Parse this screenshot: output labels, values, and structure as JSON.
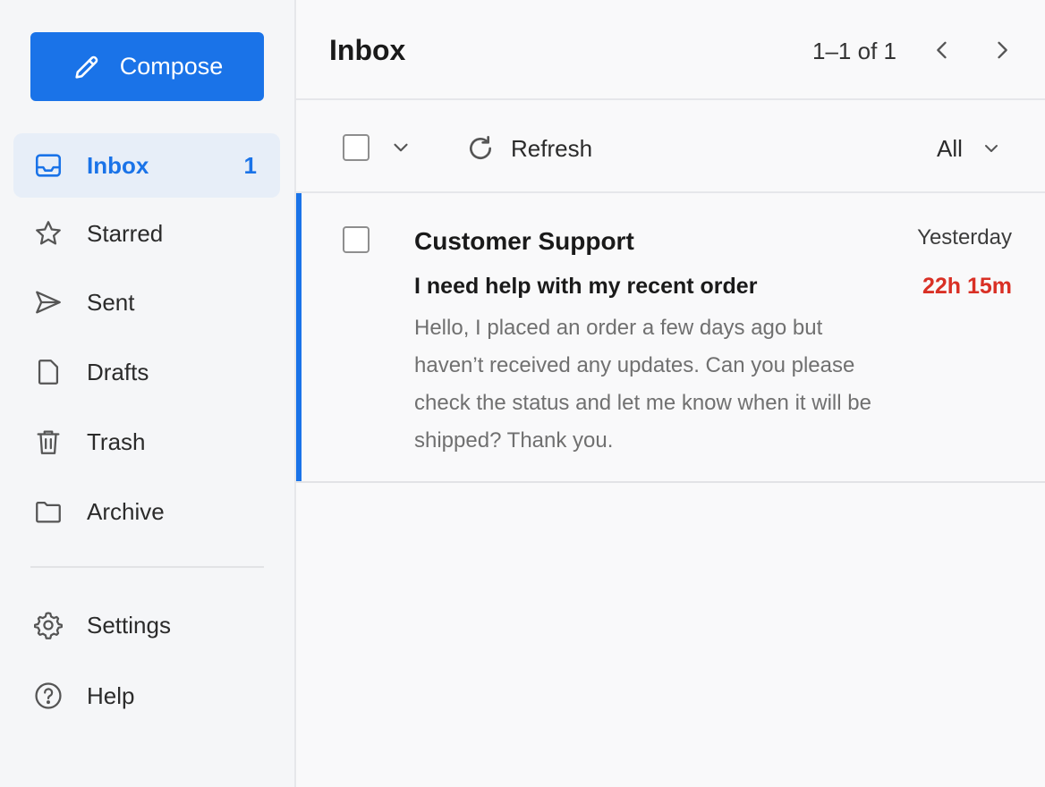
{
  "sidebar": {
    "compose_label": "Compose",
    "items": [
      {
        "label": "Inbox",
        "count": "1",
        "icon": "inbox-icon"
      },
      {
        "label": "Starred",
        "icon": "star-icon"
      },
      {
        "label": "Sent",
        "icon": "send-icon"
      },
      {
        "label": "Drafts",
        "icon": "draft-icon"
      },
      {
        "label": "Trash",
        "icon": "trash-icon"
      },
      {
        "label": "Archive",
        "icon": "folder-icon"
      }
    ],
    "footer_items": [
      {
        "label": "Settings",
        "icon": "gear-icon"
      },
      {
        "label": "Help",
        "icon": "help-icon"
      }
    ]
  },
  "header": {
    "title": "Inbox",
    "pagination": "1–1 of 1"
  },
  "toolbar": {
    "refresh_label": "Refresh",
    "filter_value": "All"
  },
  "messages": [
    {
      "sender": "Customer Support",
      "date": "Yesterday",
      "subject": "I need help with my recent order",
      "sla": "22h 15m",
      "snippet": "Hello, I placed an order a few days ago but haven’t received any updates. Can you please check the status and let me know when it will be shipped? Thank you."
    }
  ],
  "colors": {
    "accent": "#1a73e8",
    "urgent": "#d93025",
    "sidebar_bg": "#f5f6f8",
    "active_bg": "#e7eef8"
  }
}
